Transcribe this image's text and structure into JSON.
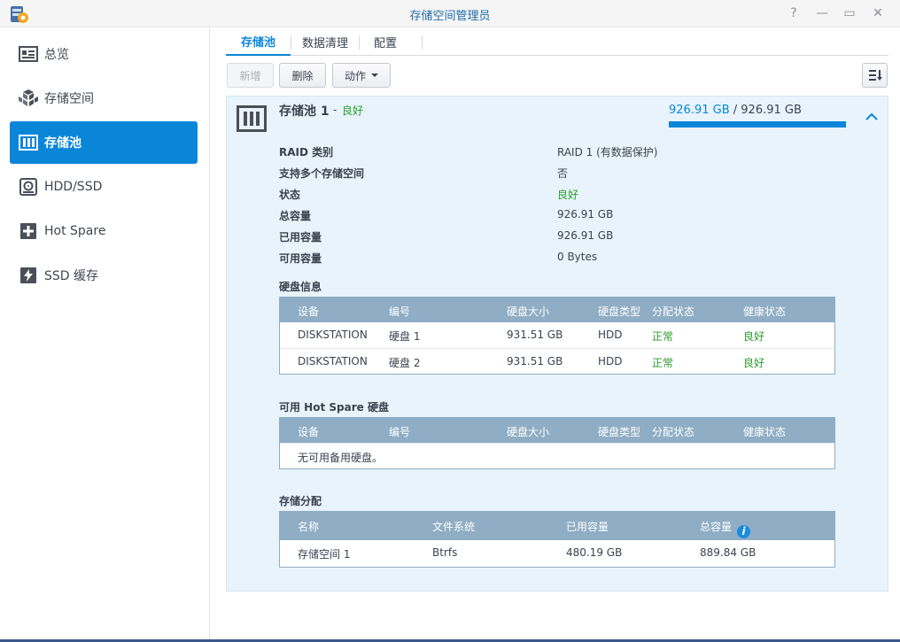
{
  "window": {
    "title": "存储空间管理员",
    "help_glyph": "?",
    "minimize_glyph": "—",
    "maximize_glyph": "▭",
    "close_glyph": "✕"
  },
  "sidebar": {
    "items": [
      {
        "label": "总览",
        "icon": "overview-icon"
      },
      {
        "label": "存储空间",
        "icon": "volume-icon"
      },
      {
        "label": "存储池",
        "icon": "storage-pool-icon",
        "active": true
      },
      {
        "label": "HDD/SSD",
        "icon": "hdd-icon"
      },
      {
        "label": "Hot Spare",
        "icon": "hot-spare-icon"
      },
      {
        "label": "SSD 缓存",
        "icon": "ssd-cache-icon"
      }
    ]
  },
  "tabs": [
    {
      "label": "存储池",
      "active": true
    },
    {
      "label": "数据清理"
    },
    {
      "label": "配置"
    }
  ],
  "toolbar": {
    "create_label": "新增",
    "delete_label": "删除",
    "action_label": "动作"
  },
  "pool": {
    "name": "存储池 1",
    "separator": "-",
    "status": "良好",
    "usage_used": "926.91 GB",
    "usage_divider": " / ",
    "usage_total": "926.91 GB",
    "usage_fraction": 1.0,
    "properties": [
      {
        "label": "RAID 类别",
        "value": "RAID 1 (有数据保护)"
      },
      {
        "label": "支持多个存储空间",
        "value": "否"
      },
      {
        "label": "状态",
        "value": "良好",
        "good": true
      },
      {
        "label": "总容量",
        "value": "926.91 GB"
      },
      {
        "label": "已用容量",
        "value": "926.91 GB"
      },
      {
        "label": "可用容量",
        "value": "0 Bytes"
      }
    ]
  },
  "disk_info": {
    "title": "硬盘信息",
    "headers": [
      "设备",
      "编号",
      "硬盘大小",
      "硬盘类型",
      "分配状态",
      "健康状态"
    ],
    "rows": [
      [
        "DISKSTATION",
        "硬盘 1",
        "931.51 GB",
        "HDD",
        "正常",
        "良好"
      ],
      [
        "DISKSTATION",
        "硬盘 2",
        "931.51 GB",
        "HDD",
        "正常",
        "良好"
      ]
    ]
  },
  "hot_spare": {
    "title": "可用 Hot Spare 硬盘",
    "headers": [
      "设备",
      "编号",
      "硬盘大小",
      "硬盘类型",
      "分配状态",
      "健康状态"
    ],
    "empty_text": "无可用备用硬盘。"
  },
  "allocation": {
    "title": "存储分配",
    "headers": [
      "名称",
      "文件系统",
      "已用容量",
      "总容量"
    ],
    "info_glyph": "i",
    "rows": [
      [
        "存储空间 1",
        "Btrfs",
        "480.19 GB",
        "889.84 GB"
      ]
    ]
  },
  "colors": {
    "accent": "#0a86d9",
    "good": "#2a9c2a",
    "grid_header": "#8fadc4",
    "panel_bg": "#e8f3fb"
  }
}
